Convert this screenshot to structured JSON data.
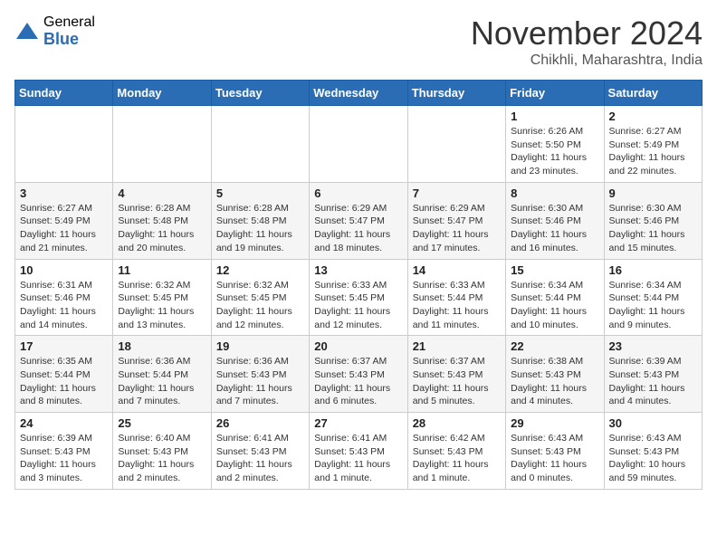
{
  "logo": {
    "general": "General",
    "blue": "Blue"
  },
  "title": "November 2024",
  "location": "Chikhli, Maharashtra, India",
  "days_of_week": [
    "Sunday",
    "Monday",
    "Tuesday",
    "Wednesday",
    "Thursday",
    "Friday",
    "Saturday"
  ],
  "weeks": [
    [
      {
        "day": null
      },
      {
        "day": null
      },
      {
        "day": null
      },
      {
        "day": null
      },
      {
        "day": null
      },
      {
        "day": "1",
        "sunrise": "6:26 AM",
        "sunset": "5:50 PM",
        "daylight": "11 hours and 23 minutes."
      },
      {
        "day": "2",
        "sunrise": "6:27 AM",
        "sunset": "5:49 PM",
        "daylight": "11 hours and 22 minutes."
      }
    ],
    [
      {
        "day": "3",
        "sunrise": "6:27 AM",
        "sunset": "5:49 PM",
        "daylight": "11 hours and 21 minutes."
      },
      {
        "day": "4",
        "sunrise": "6:28 AM",
        "sunset": "5:48 PM",
        "daylight": "11 hours and 20 minutes."
      },
      {
        "day": "5",
        "sunrise": "6:28 AM",
        "sunset": "5:48 PM",
        "daylight": "11 hours and 19 minutes."
      },
      {
        "day": "6",
        "sunrise": "6:29 AM",
        "sunset": "5:47 PM",
        "daylight": "11 hours and 18 minutes."
      },
      {
        "day": "7",
        "sunrise": "6:29 AM",
        "sunset": "5:47 PM",
        "daylight": "11 hours and 17 minutes."
      },
      {
        "day": "8",
        "sunrise": "6:30 AM",
        "sunset": "5:46 PM",
        "daylight": "11 hours and 16 minutes."
      },
      {
        "day": "9",
        "sunrise": "6:30 AM",
        "sunset": "5:46 PM",
        "daylight": "11 hours and 15 minutes."
      }
    ],
    [
      {
        "day": "10",
        "sunrise": "6:31 AM",
        "sunset": "5:46 PM",
        "daylight": "11 hours and 14 minutes."
      },
      {
        "day": "11",
        "sunrise": "6:32 AM",
        "sunset": "5:45 PM",
        "daylight": "11 hours and 13 minutes."
      },
      {
        "day": "12",
        "sunrise": "6:32 AM",
        "sunset": "5:45 PM",
        "daylight": "11 hours and 12 minutes."
      },
      {
        "day": "13",
        "sunrise": "6:33 AM",
        "sunset": "5:45 PM",
        "daylight": "11 hours and 12 minutes."
      },
      {
        "day": "14",
        "sunrise": "6:33 AM",
        "sunset": "5:44 PM",
        "daylight": "11 hours and 11 minutes."
      },
      {
        "day": "15",
        "sunrise": "6:34 AM",
        "sunset": "5:44 PM",
        "daylight": "11 hours and 10 minutes."
      },
      {
        "day": "16",
        "sunrise": "6:34 AM",
        "sunset": "5:44 PM",
        "daylight": "11 hours and 9 minutes."
      }
    ],
    [
      {
        "day": "17",
        "sunrise": "6:35 AM",
        "sunset": "5:44 PM",
        "daylight": "11 hours and 8 minutes."
      },
      {
        "day": "18",
        "sunrise": "6:36 AM",
        "sunset": "5:44 PM",
        "daylight": "11 hours and 7 minutes."
      },
      {
        "day": "19",
        "sunrise": "6:36 AM",
        "sunset": "5:43 PM",
        "daylight": "11 hours and 7 minutes."
      },
      {
        "day": "20",
        "sunrise": "6:37 AM",
        "sunset": "5:43 PM",
        "daylight": "11 hours and 6 minutes."
      },
      {
        "day": "21",
        "sunrise": "6:37 AM",
        "sunset": "5:43 PM",
        "daylight": "11 hours and 5 minutes."
      },
      {
        "day": "22",
        "sunrise": "6:38 AM",
        "sunset": "5:43 PM",
        "daylight": "11 hours and 4 minutes."
      },
      {
        "day": "23",
        "sunrise": "6:39 AM",
        "sunset": "5:43 PM",
        "daylight": "11 hours and 4 minutes."
      }
    ],
    [
      {
        "day": "24",
        "sunrise": "6:39 AM",
        "sunset": "5:43 PM",
        "daylight": "11 hours and 3 minutes."
      },
      {
        "day": "25",
        "sunrise": "6:40 AM",
        "sunset": "5:43 PM",
        "daylight": "11 hours and 2 minutes."
      },
      {
        "day": "26",
        "sunrise": "6:41 AM",
        "sunset": "5:43 PM",
        "daylight": "11 hours and 2 minutes."
      },
      {
        "day": "27",
        "sunrise": "6:41 AM",
        "sunset": "5:43 PM",
        "daylight": "11 hours and 1 minute."
      },
      {
        "day": "28",
        "sunrise": "6:42 AM",
        "sunset": "5:43 PM",
        "daylight": "11 hours and 1 minute."
      },
      {
        "day": "29",
        "sunrise": "6:43 AM",
        "sunset": "5:43 PM",
        "daylight": "11 hours and 0 minutes."
      },
      {
        "day": "30",
        "sunrise": "6:43 AM",
        "sunset": "5:43 PM",
        "daylight": "10 hours and 59 minutes."
      }
    ]
  ]
}
